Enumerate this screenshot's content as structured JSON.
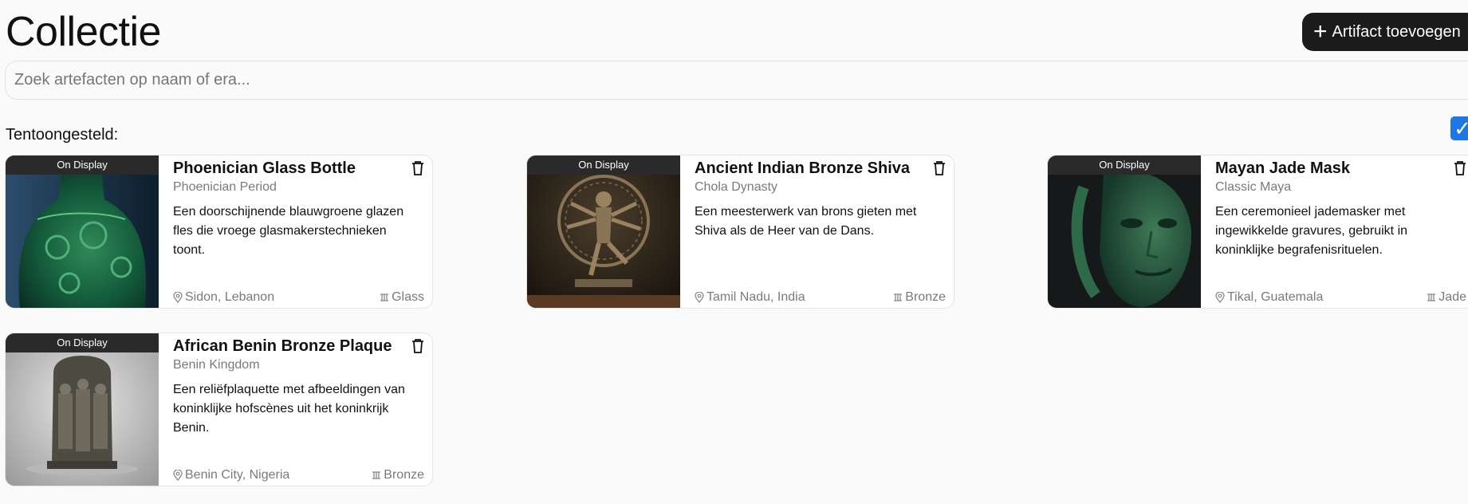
{
  "header": {
    "title": "Collectie",
    "add_button_label": "Artifact toevoegen"
  },
  "search": {
    "placeholder": "Zoek artefacten op naam of era...",
    "value": ""
  },
  "filter": {
    "label": "Tentoongesteld:",
    "checked": true
  },
  "colors": {
    "accent": "#1e78e4",
    "button_bg": "#1b1b1b",
    "muted_text": "#7a7a7a"
  },
  "artifacts": [
    {
      "badge": "On Display",
      "title": "Phoenician Glass Bottle",
      "era": "Phoenician Period",
      "description": "Een doorschijnende blauwgroene glazen fles die vroege glasmakerstechnieken toont.",
      "location": "Sidon, Lebanon",
      "material": "Glass"
    },
    {
      "badge": "On Display",
      "title": "Ancient Indian Bronze Shiva",
      "era": "Chola Dynasty",
      "description": "Een meesterwerk van brons gieten met Shiva als de Heer van de Dans.",
      "location": "Tamil Nadu, India",
      "material": "Bronze"
    },
    {
      "badge": "On Display",
      "title": "Mayan Jade Mask",
      "era": "Classic Maya",
      "description": "Een ceremonieel jademasker met ingewikkelde gravures, gebruikt in koninklijke begrafenisrituelen.",
      "location": "Tikal, Guatemala",
      "material": "Jade"
    },
    {
      "badge": "On Display",
      "title": "African Benin Bronze Plaque",
      "era": "Benin Kingdom",
      "description": "Een reliëfplaquette met afbeeldingen van koninklijke hofscènes uit het koninkrijk Benin.",
      "location": "Benin City, Nigeria",
      "material": "Bronze"
    }
  ]
}
